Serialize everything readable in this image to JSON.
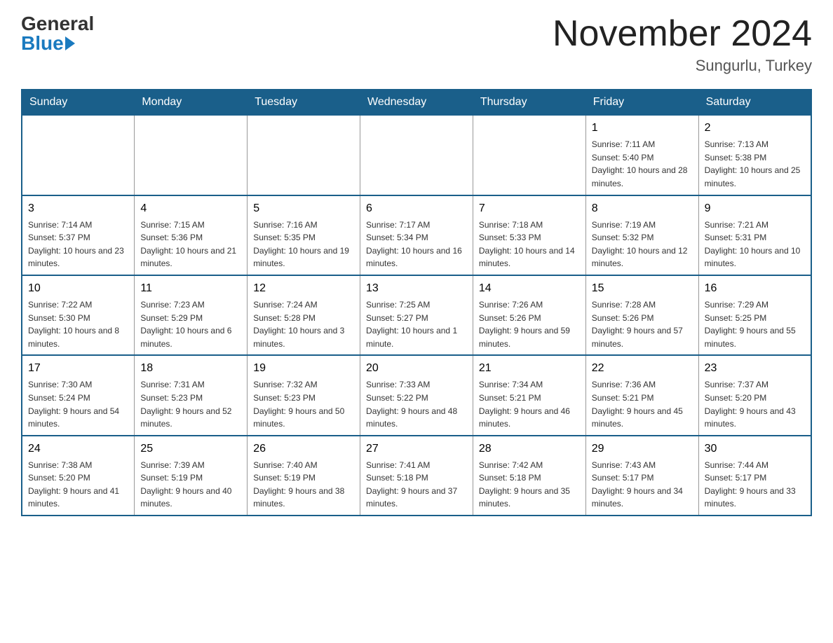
{
  "header": {
    "logo_general": "General",
    "logo_blue": "Blue",
    "month_title": "November 2024",
    "location": "Sungurlu, Turkey"
  },
  "days_of_week": [
    "Sunday",
    "Monday",
    "Tuesday",
    "Wednesday",
    "Thursday",
    "Friday",
    "Saturday"
  ],
  "weeks": [
    [
      {
        "day": "",
        "info": ""
      },
      {
        "day": "",
        "info": ""
      },
      {
        "day": "",
        "info": ""
      },
      {
        "day": "",
        "info": ""
      },
      {
        "day": "",
        "info": ""
      },
      {
        "day": "1",
        "info": "Sunrise: 7:11 AM\nSunset: 5:40 PM\nDaylight: 10 hours and 28 minutes."
      },
      {
        "day": "2",
        "info": "Sunrise: 7:13 AM\nSunset: 5:38 PM\nDaylight: 10 hours and 25 minutes."
      }
    ],
    [
      {
        "day": "3",
        "info": "Sunrise: 7:14 AM\nSunset: 5:37 PM\nDaylight: 10 hours and 23 minutes."
      },
      {
        "day": "4",
        "info": "Sunrise: 7:15 AM\nSunset: 5:36 PM\nDaylight: 10 hours and 21 minutes."
      },
      {
        "day": "5",
        "info": "Sunrise: 7:16 AM\nSunset: 5:35 PM\nDaylight: 10 hours and 19 minutes."
      },
      {
        "day": "6",
        "info": "Sunrise: 7:17 AM\nSunset: 5:34 PM\nDaylight: 10 hours and 16 minutes."
      },
      {
        "day": "7",
        "info": "Sunrise: 7:18 AM\nSunset: 5:33 PM\nDaylight: 10 hours and 14 minutes."
      },
      {
        "day": "8",
        "info": "Sunrise: 7:19 AM\nSunset: 5:32 PM\nDaylight: 10 hours and 12 minutes."
      },
      {
        "day": "9",
        "info": "Sunrise: 7:21 AM\nSunset: 5:31 PM\nDaylight: 10 hours and 10 minutes."
      }
    ],
    [
      {
        "day": "10",
        "info": "Sunrise: 7:22 AM\nSunset: 5:30 PM\nDaylight: 10 hours and 8 minutes."
      },
      {
        "day": "11",
        "info": "Sunrise: 7:23 AM\nSunset: 5:29 PM\nDaylight: 10 hours and 6 minutes."
      },
      {
        "day": "12",
        "info": "Sunrise: 7:24 AM\nSunset: 5:28 PM\nDaylight: 10 hours and 3 minutes."
      },
      {
        "day": "13",
        "info": "Sunrise: 7:25 AM\nSunset: 5:27 PM\nDaylight: 10 hours and 1 minute."
      },
      {
        "day": "14",
        "info": "Sunrise: 7:26 AM\nSunset: 5:26 PM\nDaylight: 9 hours and 59 minutes."
      },
      {
        "day": "15",
        "info": "Sunrise: 7:28 AM\nSunset: 5:26 PM\nDaylight: 9 hours and 57 minutes."
      },
      {
        "day": "16",
        "info": "Sunrise: 7:29 AM\nSunset: 5:25 PM\nDaylight: 9 hours and 55 minutes."
      }
    ],
    [
      {
        "day": "17",
        "info": "Sunrise: 7:30 AM\nSunset: 5:24 PM\nDaylight: 9 hours and 54 minutes."
      },
      {
        "day": "18",
        "info": "Sunrise: 7:31 AM\nSunset: 5:23 PM\nDaylight: 9 hours and 52 minutes."
      },
      {
        "day": "19",
        "info": "Sunrise: 7:32 AM\nSunset: 5:23 PM\nDaylight: 9 hours and 50 minutes."
      },
      {
        "day": "20",
        "info": "Sunrise: 7:33 AM\nSunset: 5:22 PM\nDaylight: 9 hours and 48 minutes."
      },
      {
        "day": "21",
        "info": "Sunrise: 7:34 AM\nSunset: 5:21 PM\nDaylight: 9 hours and 46 minutes."
      },
      {
        "day": "22",
        "info": "Sunrise: 7:36 AM\nSunset: 5:21 PM\nDaylight: 9 hours and 45 minutes."
      },
      {
        "day": "23",
        "info": "Sunrise: 7:37 AM\nSunset: 5:20 PM\nDaylight: 9 hours and 43 minutes."
      }
    ],
    [
      {
        "day": "24",
        "info": "Sunrise: 7:38 AM\nSunset: 5:20 PM\nDaylight: 9 hours and 41 minutes."
      },
      {
        "day": "25",
        "info": "Sunrise: 7:39 AM\nSunset: 5:19 PM\nDaylight: 9 hours and 40 minutes."
      },
      {
        "day": "26",
        "info": "Sunrise: 7:40 AM\nSunset: 5:19 PM\nDaylight: 9 hours and 38 minutes."
      },
      {
        "day": "27",
        "info": "Sunrise: 7:41 AM\nSunset: 5:18 PM\nDaylight: 9 hours and 37 minutes."
      },
      {
        "day": "28",
        "info": "Sunrise: 7:42 AM\nSunset: 5:18 PM\nDaylight: 9 hours and 35 minutes."
      },
      {
        "day": "29",
        "info": "Sunrise: 7:43 AM\nSunset: 5:17 PM\nDaylight: 9 hours and 34 minutes."
      },
      {
        "day": "30",
        "info": "Sunrise: 7:44 AM\nSunset: 5:17 PM\nDaylight: 9 hours and 33 minutes."
      }
    ]
  ]
}
